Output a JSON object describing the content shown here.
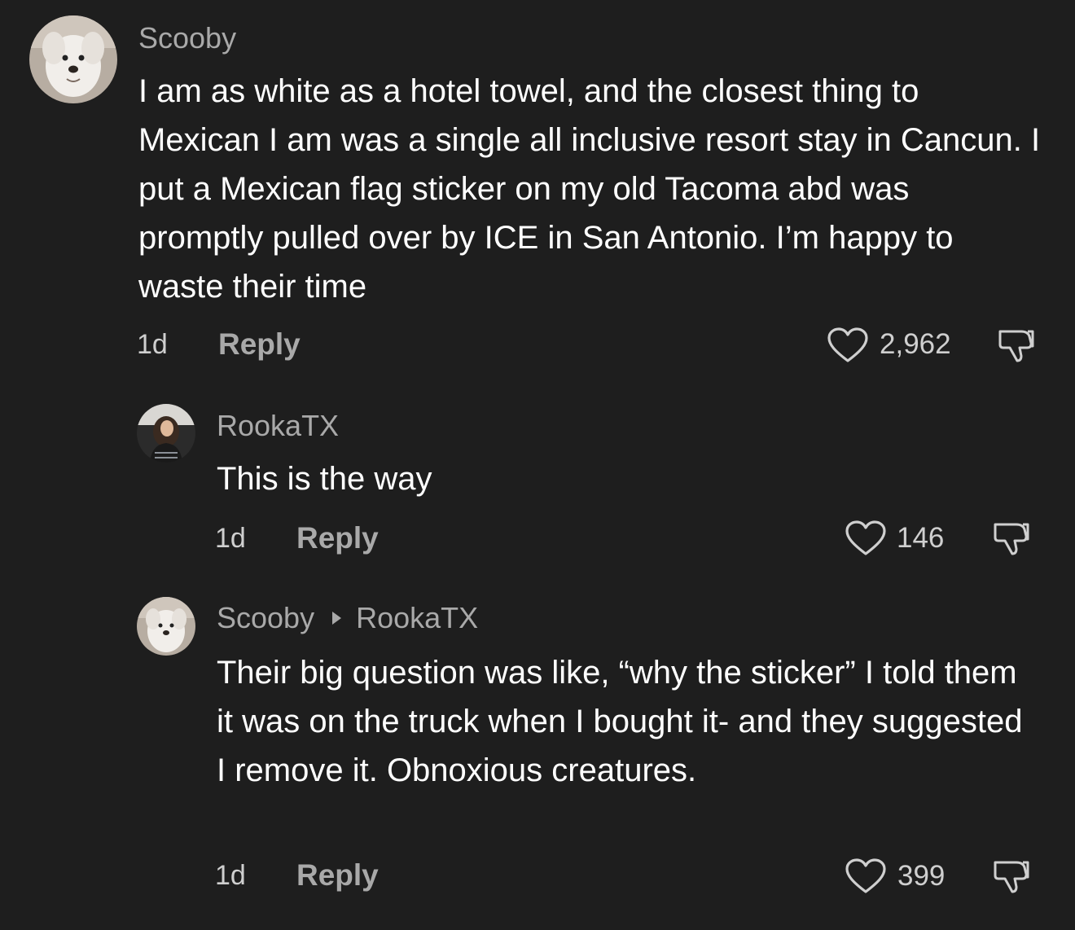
{
  "comments": [
    {
      "username": "Scooby",
      "text": "I am as white as a hotel towel, and the closest thing to Mexican I am was a single all inclusive resort stay in Cancun. I put a Mexican flag sticker on my old Tacoma abd was promptly pulled over by ICE in San Antonio. I’m happy to waste their time",
      "time": "1d",
      "reply_label": "Reply",
      "likes": "2,962",
      "avatar_icon": "dog-avatar"
    },
    {
      "username": "RookaTX",
      "text": "This is the way",
      "time": "1d",
      "reply_label": "Reply",
      "likes": "146",
      "avatar_icon": "person-avatar"
    },
    {
      "username": "Scooby",
      "reply_to": "RookaTX",
      "text": "Their big question was like, “why the sticker” I told them it was on the truck when I bought it- and they suggested I remove it. Obnoxious creatures.",
      "time": "1d",
      "reply_label": "Reply",
      "likes": "399",
      "avatar_icon": "dog-avatar"
    }
  ],
  "colors": {
    "background": "#1e1e1e",
    "primary_text": "#ffffff",
    "secondary_text": "#a9a9a9"
  }
}
